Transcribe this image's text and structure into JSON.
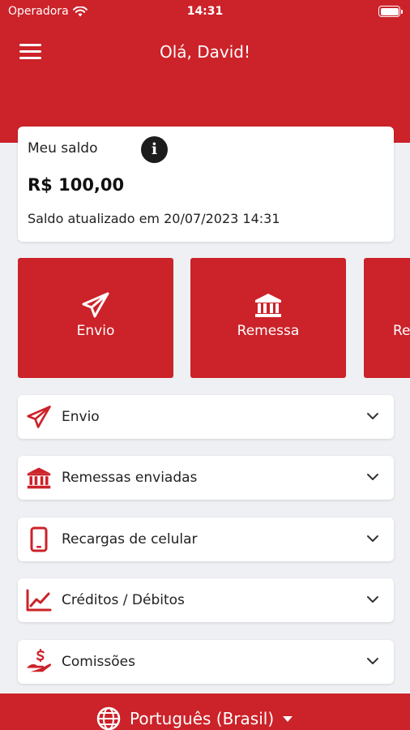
{
  "status_bar": {
    "carrier": "Operadora",
    "time": "14:31"
  },
  "header": {
    "greeting": "Olá, David!"
  },
  "balance": {
    "label": "Meu saldo",
    "value": "R$ 100,00",
    "updated": "Saldo atualizado em 20/07/2023 14:31"
  },
  "quick_actions": [
    {
      "label": "Envio",
      "icon": "paper-plane-icon"
    },
    {
      "label": "Remessa",
      "icon": "bank-icon"
    },
    {
      "label": "Re",
      "icon": ""
    }
  ],
  "menu_items": [
    {
      "label": "Envio",
      "icon": "paper-plane-icon"
    },
    {
      "label": "Remessas enviadas",
      "icon": "bank-icon"
    },
    {
      "label": "Recargas de celular",
      "icon": "mobile-phone-icon"
    },
    {
      "label": "Créditos / Débitos",
      "icon": "line-chart-icon"
    },
    {
      "label": "Comissões",
      "icon": "hand-money-icon"
    }
  ],
  "footer": {
    "language": "Português (Brasil)"
  },
  "colors": {
    "brand": "#cc2229",
    "background": "#eef0f3"
  }
}
